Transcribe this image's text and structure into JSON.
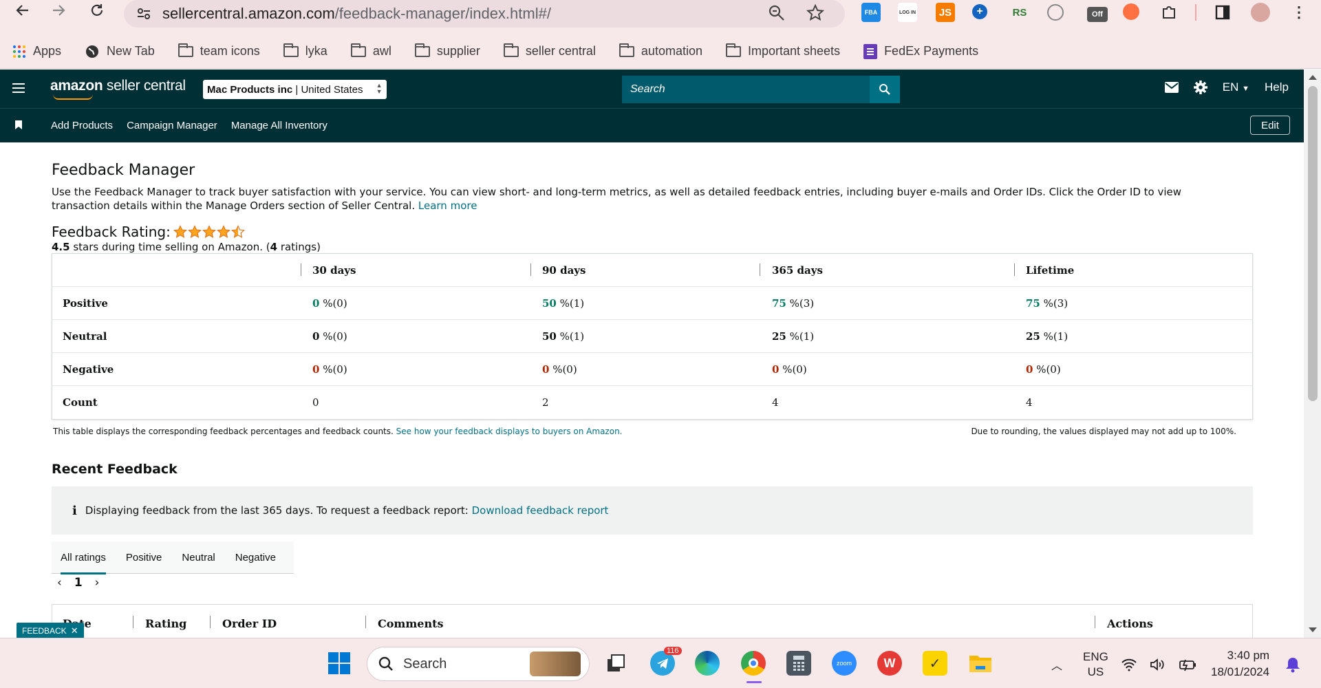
{
  "browser": {
    "url_domain": "sellercentral.amazon.com",
    "url_path": "/feedback-manager/index.html#/",
    "bookmarks": [
      "Apps",
      "New Tab",
      "team icons",
      "lyka",
      "awl",
      "supplier",
      "seller central",
      "automation",
      "Important sheets",
      "FedEx Payments"
    ],
    "extensions": [
      "FBA",
      "LOG IN",
      "JS",
      "RS",
      "Off"
    ],
    "colors": {
      "chrome_bg": "#f7e8ea",
      "omnibox_bg": "#ecdcdf"
    }
  },
  "header": {
    "logo_bold": "amazon",
    "logo_rest": " seller central",
    "account_name": "Mac Products inc",
    "account_region": "United States",
    "search_placeholder": "Search",
    "language": "EN",
    "help": "Help",
    "nav_links": [
      "Add Products",
      "Campaign Manager",
      "Manage All Inventory"
    ],
    "edit": "Edit",
    "colors": {
      "header_bg": "#002f36",
      "search_bg": "#005a6b",
      "search_btn": "#007185"
    }
  },
  "page": {
    "title": "Feedback Manager",
    "intro": "Use the Feedback Manager to track buyer satisfaction with your service. You can view short- and long-term metrics, as well as detailed feedback entries, including buyer e-mails and Order IDs. Click the Order ID to view transaction details within the Manage Orders section of Seller Central.",
    "learn_more": "Learn more",
    "rating_label": "Feedback Rating:",
    "rating_stars": 4.5,
    "rating_value": "4.5",
    "rating_text_mid": " stars during time selling on Amazon. (",
    "rating_count": "4",
    "rating_text_end": " ratings)",
    "table": {
      "columns": [
        "30 days",
        "90 days",
        "365 days",
        "Lifetime"
      ],
      "rows": [
        {
          "label": "Positive",
          "cells": [
            {
              "pct": "0",
              "rest": " %(0)"
            },
            {
              "pct": "50",
              "rest": " %(1)"
            },
            {
              "pct": "75",
              "rest": " %(3)"
            },
            {
              "pct": "75",
              "rest": " %(3)"
            }
          ]
        },
        {
          "label": "Neutral",
          "cells": [
            {
              "pct": "0",
              "rest": " %(0)"
            },
            {
              "pct": "50",
              "rest": " %(1)"
            },
            {
              "pct": "25",
              "rest": " %(1)"
            },
            {
              "pct": "25",
              "rest": " %(1)"
            }
          ]
        },
        {
          "label": "Negative",
          "cells": [
            {
              "pct": "0",
              "rest": " %(0)"
            },
            {
              "pct": "0",
              "rest": " %(0)"
            },
            {
              "pct": "0",
              "rest": " %(0)"
            },
            {
              "pct": "0",
              "rest": " %(0)"
            }
          ]
        },
        {
          "label": "Count",
          "cells": [
            {
              "pct": "",
              "rest": "0"
            },
            {
              "pct": "",
              "rest": "2"
            },
            {
              "pct": "",
              "rest": "4"
            },
            {
              "pct": "",
              "rest": "4"
            }
          ]
        }
      ]
    },
    "table_note": "This table displays the corresponding feedback percentages and feedback counts.",
    "table_note_link": "See how your feedback displays to buyers on Amazon.",
    "table_note_right": "Due to rounding, the values displayed may not add up to 100%.",
    "recent_title": "Recent Feedback",
    "info_text": "Displaying feedback from the last 365 days. To request a feedback report:",
    "info_link": "Download feedback report",
    "tabs": [
      "All ratings",
      "Positive",
      "Neutral",
      "Negative"
    ],
    "active_tab": "All ratings",
    "page_number": "1",
    "list_columns": [
      "Date",
      "Rating",
      "Order ID",
      "Comments",
      "Actions"
    ],
    "feedback_tab": "FEEDBACK"
  },
  "taskbar": {
    "search": "Search",
    "telegram_badge": "116",
    "lang_top": "ENG",
    "lang_bottom": "US",
    "time": "3:40 pm",
    "date": "18/01/2024"
  }
}
